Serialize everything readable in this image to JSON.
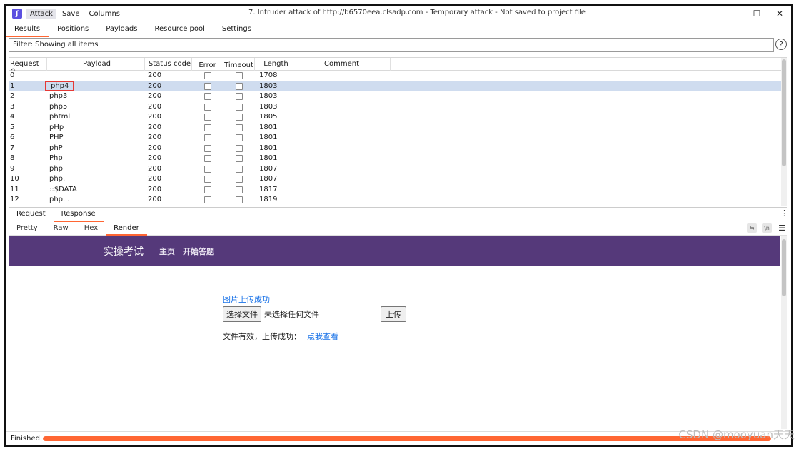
{
  "window": {
    "title": "7. Intruder attack of http://b6570eea.clsadp.com - Temporary attack - Not saved to project file",
    "menu": [
      "Attack",
      "Save",
      "Columns"
    ],
    "controls": {
      "minimize": "—",
      "maximize": "☐",
      "close": "✕"
    }
  },
  "tabs": [
    "Results",
    "Positions",
    "Payloads",
    "Resource pool",
    "Settings"
  ],
  "filter": {
    "text": "Filter: Showing all items"
  },
  "table": {
    "columns": [
      "Request ^",
      "Payload",
      "Status code",
      "Error",
      "Timeout",
      "Length",
      "Comment"
    ],
    "rows": [
      {
        "request": "0",
        "payload": "",
        "status": "200",
        "length": "1708"
      },
      {
        "request": "1",
        "payload": "php4",
        "status": "200",
        "length": "1803"
      },
      {
        "request": "2",
        "payload": "php3",
        "status": "200",
        "length": "1803"
      },
      {
        "request": "3",
        "payload": "php5",
        "status": "200",
        "length": "1803"
      },
      {
        "request": "4",
        "payload": "phtml",
        "status": "200",
        "length": "1805"
      },
      {
        "request": "5",
        "payload": "pHp",
        "status": "200",
        "length": "1801"
      },
      {
        "request": "6",
        "payload": "PHP",
        "status": "200",
        "length": "1801"
      },
      {
        "request": "7",
        "payload": "phP",
        "status": "200",
        "length": "1801"
      },
      {
        "request": "8",
        "payload": "Php",
        "status": "200",
        "length": "1801"
      },
      {
        "request": "9",
        "payload": "php",
        "status": "200",
        "length": "1807"
      },
      {
        "request": "10",
        "payload": "php.",
        "status": "200",
        "length": "1807"
      },
      {
        "request": "11",
        "payload": "::$DATA",
        "status": "200",
        "length": "1817"
      },
      {
        "request": "12",
        "payload": "php. .",
        "status": "200",
        "length": "1819"
      }
    ]
  },
  "rr_tabs": [
    "Request",
    "Response"
  ],
  "view_tabs": [
    "Pretty",
    "Raw",
    "Hex",
    "Render"
  ],
  "render": {
    "brand": "实操考试",
    "nav_links": [
      "主页",
      "开始答题"
    ],
    "upload_message": "图片上传成功",
    "file_button": "选择文件",
    "file_status": "未选择任何文件",
    "submit_button": "上传",
    "result_text": "文件有效，上传成功：",
    "result_link": "点我查看"
  },
  "status": {
    "text": "Finished",
    "progress": 1.0
  },
  "watermark": "CSDN @mooyuan天天",
  "colors": {
    "accent": "#ff6633",
    "selected_row": "#cfdcef",
    "site_nav": "#55397a",
    "link": "#1a73e8",
    "highlight_box": "#e53935"
  }
}
